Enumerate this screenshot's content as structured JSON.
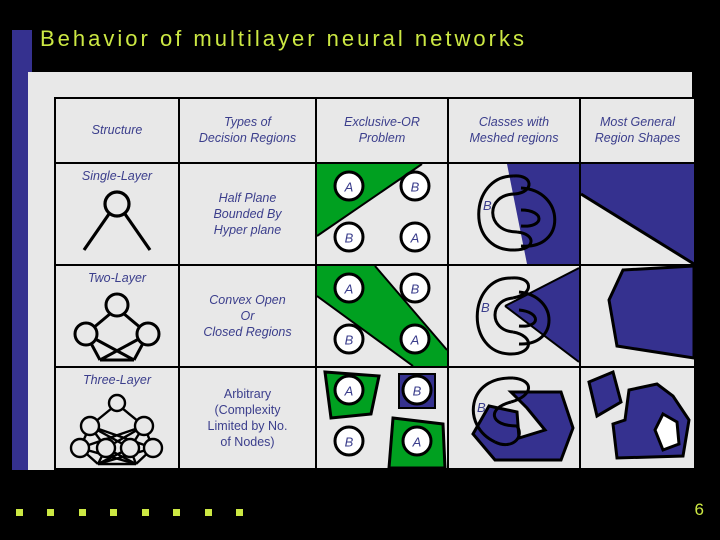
{
  "slide": {
    "title": "Behavior of multilayer neural networks",
    "page_number": "6",
    "colors": {
      "background": "#000000",
      "title_text": "#CCE843",
      "accent_bar": "#35318F",
      "panel": "#E8E8E8",
      "table_text": "#3B3E8C",
      "region_green": "#00A020",
      "region_blue": "#35318F"
    },
    "bullet_dots_count": 8
  },
  "table": {
    "headers": [
      "Structure",
      "Types of Decision Regions",
      "Exclusive-OR Problem",
      "Classes with Meshed regions",
      "Most General Region Shapes"
    ],
    "headers_lines": [
      [
        "Structure"
      ],
      [
        "Types of",
        "Decision Regions"
      ],
      [
        "Exclusive-OR",
        "Problem"
      ],
      [
        "Classes with",
        "Meshed regions"
      ],
      [
        "Most General",
        "Region Shapes"
      ]
    ],
    "rows": [
      {
        "structure": "Single-Layer",
        "structure_diagram": "single-layer-perceptron-diagram",
        "decision_regions_lines": [
          "Half Plane",
          "Bounded By",
          "Hyper plane"
        ],
        "xor_diagram": "half-plane-diagonal-split",
        "xor_labels": [
          "A",
          "B",
          "B",
          "A"
        ],
        "meshed_diagram": "meshed-regions-straight-boundary",
        "meshed_label": "B",
        "general_shapes_diagram": "half-plane-region"
      },
      {
        "structure": "Two-Layer",
        "structure_diagram": "two-layer-network-diagram",
        "decision_regions_lines": [
          "Convex Open",
          "Or",
          "Closed Regions"
        ],
        "xor_diagram": "convex-diagonal-band",
        "xor_labels": [
          "A",
          "B",
          "B",
          "A"
        ],
        "meshed_diagram": "meshed-regions-convex-wedge",
        "meshed_label": "B",
        "general_shapes_diagram": "convex-polygon-region"
      },
      {
        "structure": "Three-Layer",
        "structure_diagram": "three-layer-network-diagram",
        "decision_regions_lines": [
          "Arbitrary",
          "(Complexity",
          "Limited by No.",
          "of Nodes)"
        ],
        "xor_diagram": "arbitrary-polygon-regions",
        "xor_labels": [
          "A",
          "B",
          "B",
          "A"
        ],
        "meshed_diagram": "meshed-regions-arbitrary-spiral",
        "meshed_label": "B",
        "general_shapes_diagram": "arbitrary-disjoint-regions-with-hole"
      }
    ]
  }
}
